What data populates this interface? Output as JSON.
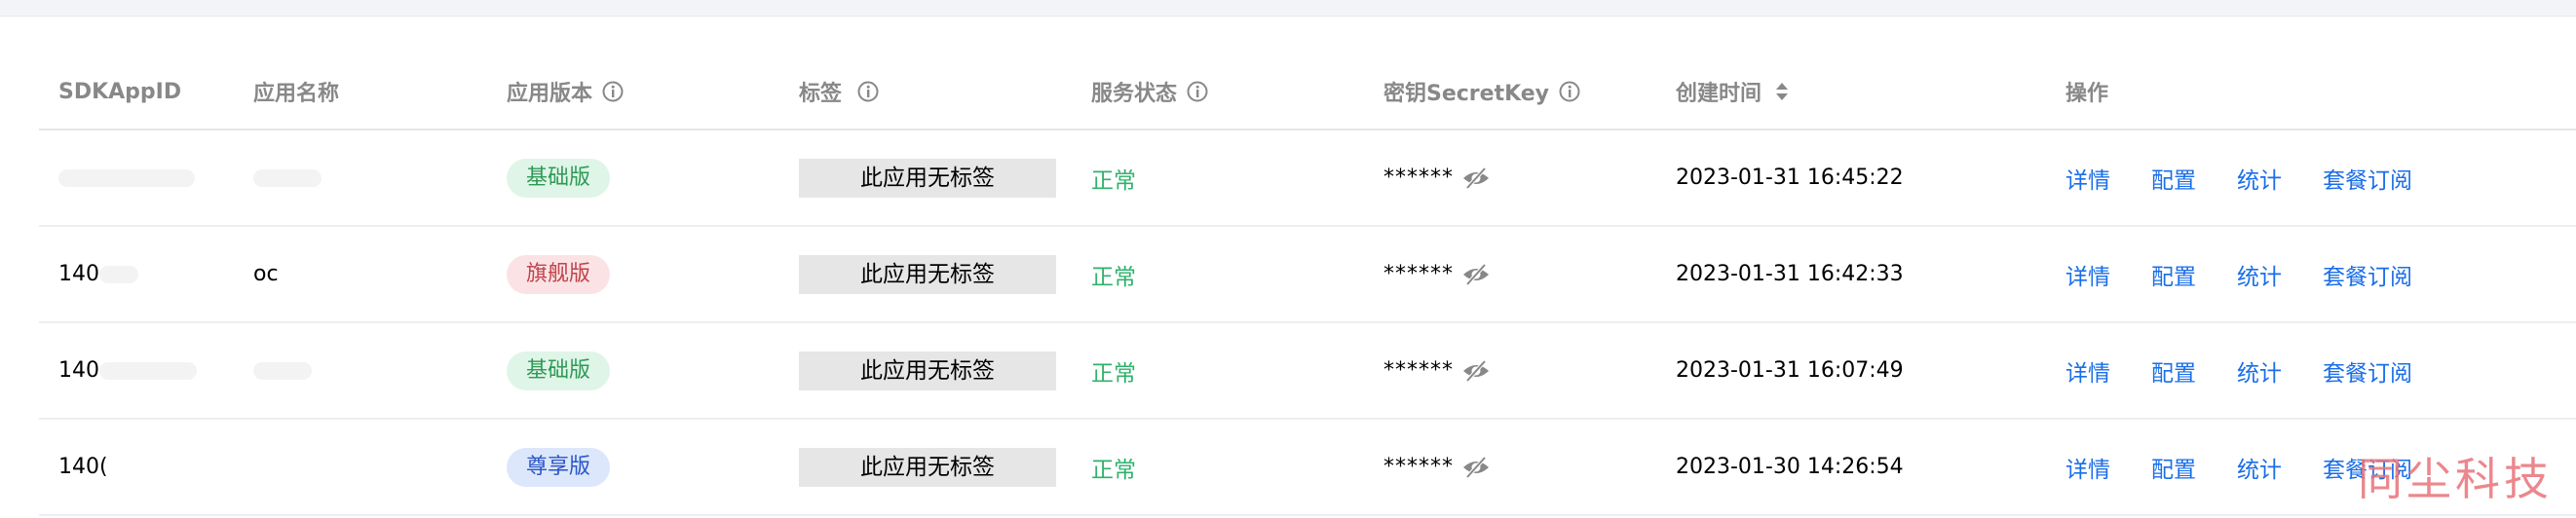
{
  "header": {
    "sdkappid": "SDKAppID",
    "app_name": "应用名称",
    "app_version": "应用版本",
    "tag": "标签",
    "service_status": "服务状态",
    "secret_key": "密钥SecretKey",
    "created_time": "创建时间",
    "actions": "操作"
  },
  "rows": [
    {
      "id": "",
      "name": "",
      "version": "基础版",
      "version_color": "#2e9a55",
      "version_bg": "#dff5e8",
      "tag": "此应用无标签",
      "status": "正常",
      "key": "******",
      "created": "2023-01-31 16:45:22"
    },
    {
      "id": "140",
      "name": "oc",
      "version": "旗舰版",
      "version_color": "#c0434c",
      "version_bg": "#fbe3e5",
      "tag": "此应用无标签",
      "status": "正常",
      "key": "******",
      "created": "2023-01-31 16:42:33"
    },
    {
      "id": "140",
      "name": "",
      "version": "基础版",
      "version_color": "#2e9a55",
      "version_bg": "#dff5e8",
      "tag": "此应用无标签",
      "status": "正常",
      "key": "******",
      "created": "2023-01-31 16:07:49"
    },
    {
      "id": "140(",
      "name": "",
      "version": "尊享版",
      "version_color": "#2b56c8",
      "version_bg": "#dce7fb",
      "tag": "此应用无标签",
      "status": "正常",
      "key": "******",
      "created": "2023-01-30 14:26:54"
    }
  ],
  "actions": {
    "detail": "详情",
    "config": "配置",
    "stats": "统计",
    "subscribe": "套餐订阅"
  },
  "watermark": "同尘科技",
  "colors": {
    "link": "#1a6ee8",
    "status_ok": "#2fb26b"
  }
}
